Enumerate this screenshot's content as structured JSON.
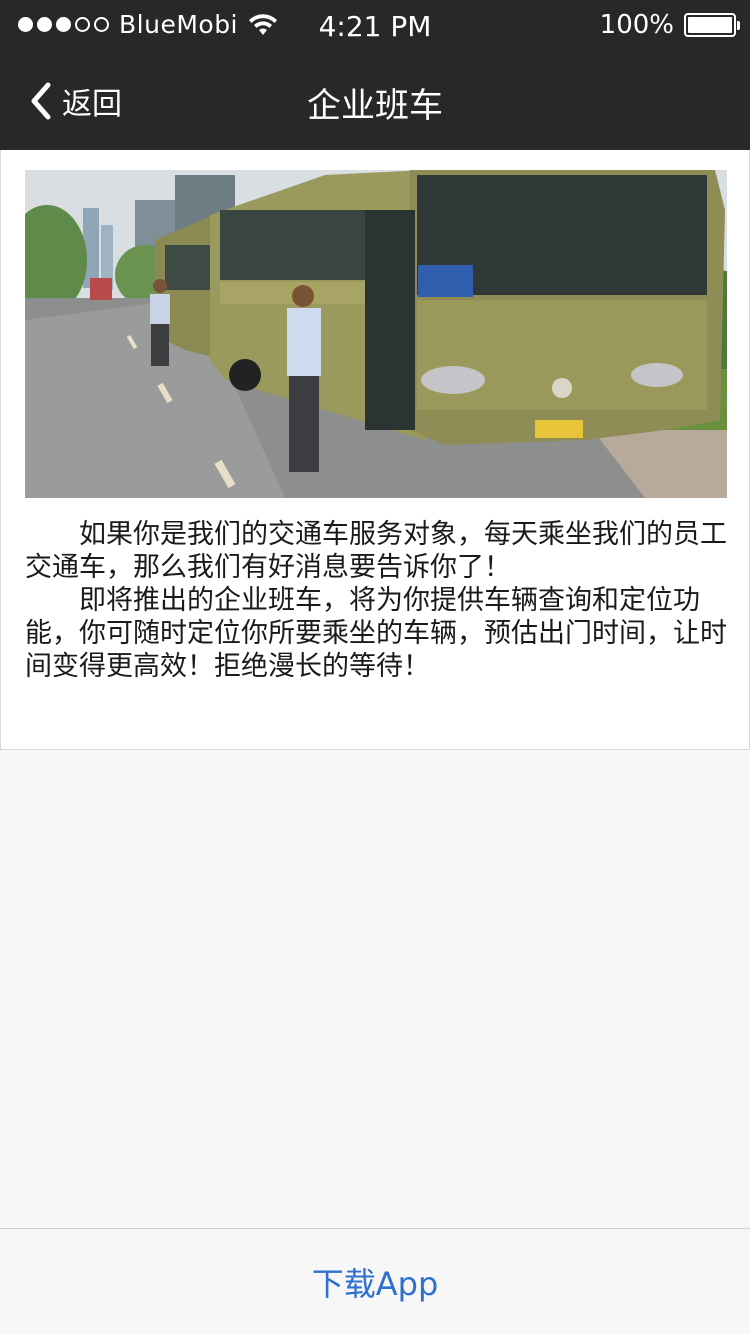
{
  "status_bar": {
    "carrier": "BlueMobi",
    "time": "4:21 PM",
    "battery": "100%",
    "signal_strength": 3,
    "signal_max": 5
  },
  "nav": {
    "back_label": "返回",
    "title": "企业班车"
  },
  "article": {
    "paragraph1": "如果你是我们的交通车服务对象，每天乘坐我们的员工交通车，那么我们有好消息要告诉你了！",
    "paragraph2": "即将推出的企业班车，将为你提供车辆查询和定位功能，你可随时定位你所要乘坐的车辆，预估出门时间，让时间变得更高效！拒绝漫长的等待！"
  },
  "bottom": {
    "download_label": "下载App"
  },
  "colors": {
    "nav_background": "#28282a",
    "link_blue": "#2f6fd0",
    "page_background": "#f7f7f7"
  }
}
